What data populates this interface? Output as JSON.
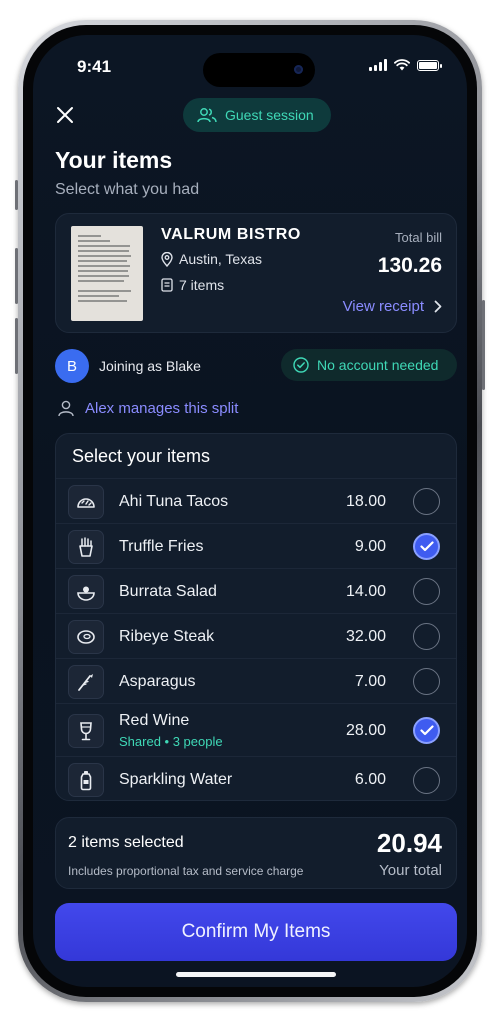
{
  "status_bar": {
    "time": "9:41"
  },
  "header": {
    "session_badge": "Guest session"
  },
  "page": {
    "title": "Your items",
    "subtitle": "Select what you had"
  },
  "receipt": {
    "restaurant": "VALRUM BISTRO",
    "location": "Austin, Texas",
    "items_count": "7 items",
    "total_label": "Total bill",
    "total_value": "130.26",
    "view_link": "View receipt"
  },
  "participant": {
    "avatar_initial": "B",
    "joining_text": "Joining as Blake",
    "no_account_badge": "No account needed",
    "manager_text": "Alex manages this split"
  },
  "items_section": {
    "heading": "Select your items",
    "items": [
      {
        "name": "Ahi Tuna Tacos",
        "price": "18.00",
        "selected": false,
        "icon": "taco-icon",
        "sub": ""
      },
      {
        "name": "Truffle Fries",
        "price": "9.00",
        "selected": true,
        "icon": "fries-icon",
        "sub": ""
      },
      {
        "name": "Burrata Salad",
        "price": "14.00",
        "selected": false,
        "icon": "salad-icon",
        "sub": ""
      },
      {
        "name": "Ribeye Steak",
        "price": "32.00",
        "selected": false,
        "icon": "steak-icon",
        "sub": ""
      },
      {
        "name": "Asparagus",
        "price": "7.00",
        "selected": false,
        "icon": "asparagus-icon",
        "sub": ""
      },
      {
        "name": "Red Wine",
        "price": "28.00",
        "selected": true,
        "icon": "wine-glass-icon",
        "sub": "Shared • 3 people"
      },
      {
        "name": "Sparkling Water",
        "price": "6.00",
        "selected": false,
        "icon": "water-bottle-icon",
        "sub": ""
      }
    ]
  },
  "summary": {
    "count_text": "2 items selected",
    "note": "Includes proportional tax and service charge",
    "total": "20.94",
    "total_label": "Your total"
  },
  "actions": {
    "confirm_label": "Confirm My Items"
  },
  "colors": {
    "accent": "#3f5cf0",
    "teal": "#3fd8b6",
    "link": "#8a8cff",
    "background": "#0b1422"
  }
}
